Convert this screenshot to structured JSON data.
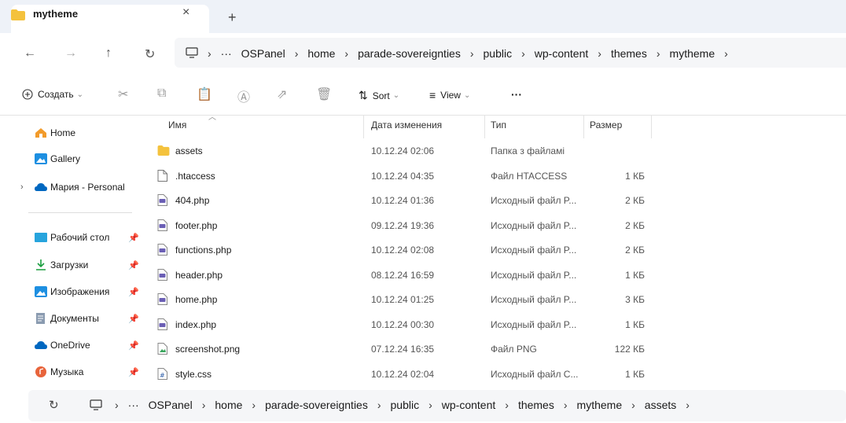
{
  "tab": {
    "title": "mytheme",
    "close": "×",
    "new": "+"
  },
  "nav": {
    "back": "←",
    "forward": "→",
    "up": "↑",
    "refresh": "↻"
  },
  "breadcrumb": {
    "more": "···",
    "items": [
      "OSPanel",
      "home",
      "parade-sovereignties",
      "public",
      "wp-content",
      "themes",
      "mytheme"
    ]
  },
  "toolbar": {
    "create": "Создать",
    "sort": "Sort",
    "view": "View",
    "more": "···"
  },
  "sidebar": {
    "top": [
      "Home",
      "Gallery",
      "Мария - Personal"
    ],
    "pinned": [
      "Рабочий стол",
      "Загрузки",
      "Изображения",
      "Документы",
      "OneDrive",
      "Музыка"
    ]
  },
  "columns": {
    "name": "Имя",
    "date": "Дата изменения",
    "type": "Тип",
    "size": "Размер"
  },
  "files": [
    {
      "name": "assets",
      "date": "10.12.24 02:06",
      "type": "Папка з файламі",
      "size": "",
      "icon": "folder"
    },
    {
      "name": ".htaccess",
      "date": "10.12.24 04:35",
      "type": "Файл HTACCESS",
      "size": "1 КБ",
      "icon": "file"
    },
    {
      "name": "404.php",
      "date": "10.12.24 01:36",
      "type": "Исходный файл P...",
      "size": "2 КБ",
      "icon": "php"
    },
    {
      "name": "footer.php",
      "date": "09.12.24 19:36",
      "type": "Исходный файл P...",
      "size": "2 КБ",
      "icon": "php"
    },
    {
      "name": "functions.php",
      "date": "10.12.24 02:08",
      "type": "Исходный файл P...",
      "size": "2 КБ",
      "icon": "php"
    },
    {
      "name": "header.php",
      "date": "08.12.24 16:59",
      "type": "Исходный файл P...",
      "size": "1 КБ",
      "icon": "php"
    },
    {
      "name": "home.php",
      "date": "10.12.24 01:25",
      "type": "Исходный файл P...",
      "size": "3 КБ",
      "icon": "php"
    },
    {
      "name": "index.php",
      "date": "10.12.24 00:30",
      "type": "Исходный файл P...",
      "size": "1 КБ",
      "icon": "php"
    },
    {
      "name": "screenshot.png",
      "date": "07.12.24 16:35",
      "type": "Файл PNG",
      "size": "122 КБ",
      "icon": "image"
    },
    {
      "name": "style.css",
      "date": "10.12.24 02:04",
      "type": "Исходный файл С...",
      "size": "1 КБ",
      "icon": "css"
    }
  ],
  "bottom_breadcrumb": {
    "refresh": "↻",
    "more": "···",
    "items": [
      "OSPanel",
      "home",
      "parade-sovereignties",
      "public",
      "wp-content",
      "themes",
      "mytheme",
      "assets"
    ]
  },
  "colors": {
    "folder": "#f4c23d",
    "accent": "#0067c0",
    "php": "#6b5fb5"
  }
}
